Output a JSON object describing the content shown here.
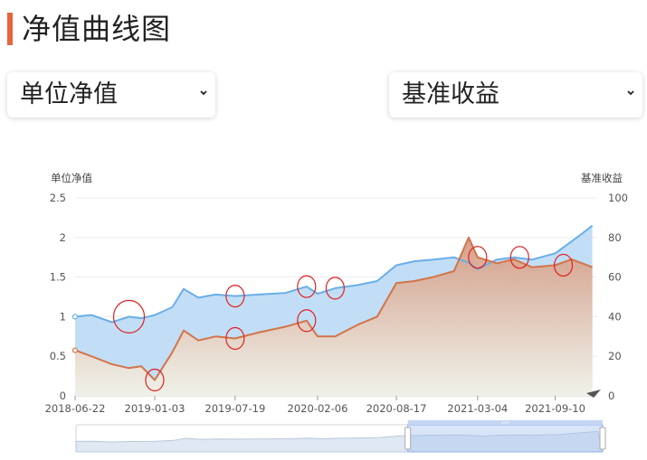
{
  "page": {
    "title": "净值曲线图"
  },
  "controls": {
    "left_select": {
      "selected": "单位净值"
    },
    "right_select": {
      "selected": "基准收益"
    }
  },
  "colors": {
    "accent": "#e8643c",
    "nav_line": "#6aaee8",
    "nav_fill": "#bcdcf7",
    "bench_line": "#d2744a",
    "bench_fill": "#d8a28a",
    "highlight": "#e02020"
  },
  "chart_data": {
    "type": "line",
    "dual_axis": true,
    "x_tick_labels": [
      "2018-06-22",
      "2019-01-03",
      "2019-07-19",
      "2020-02-06",
      "2020-08-17",
      "2021-03-04",
      "2021-09-10"
    ],
    "yleft_label": "单位净值",
    "yright_label": "基准收益",
    "yleft_ticks": [
      "0",
      "0.5",
      "1",
      "1.5",
      "2",
      "2.5"
    ],
    "yright_ticks": [
      "0",
      "20",
      "40",
      "60",
      "80",
      "100"
    ],
    "yleft_lim": [
      0,
      2.5
    ],
    "yright_lim": [
      0,
      100
    ],
    "grid": true,
    "series": [
      {
        "axis": "left",
        "color": "#6aaee8",
        "x": [
          "2018-06-22",
          "2018-08-01",
          "2018-09-20",
          "2018-11-01",
          "2018-12-01",
          "2019-01-03",
          "2019-02-15",
          "2019-03-15",
          "2019-04-20",
          "2019-06-01",
          "2019-07-19",
          "2019-09-15",
          "2019-11-20",
          "2020-01-10",
          "2020-02-06",
          "2020-03-20",
          "2020-05-15",
          "2020-07-01",
          "2020-08-17",
          "2020-09-30",
          "2020-11-15",
          "2021-01-05",
          "2021-02-10",
          "2021-03-04",
          "2021-04-20",
          "2021-06-01",
          "2021-07-15",
          "2021-09-10",
          "2021-10-20",
          "2021-11-15",
          "2021-12-10"
        ],
        "values": [
          1.0,
          1.02,
          0.93,
          1.0,
          0.98,
          1.02,
          1.12,
          1.35,
          1.24,
          1.28,
          1.26,
          1.28,
          1.3,
          1.38,
          1.29,
          1.36,
          1.4,
          1.45,
          1.65,
          1.7,
          1.72,
          1.75,
          1.68,
          1.6,
          1.72,
          1.75,
          1.72,
          1.8,
          1.95,
          2.05,
          2.15
        ]
      },
      {
        "axis": "right",
        "color": "#d2744a",
        "x": [
          "2018-06-22",
          "2018-08-01",
          "2018-09-20",
          "2018-11-01",
          "2018-12-01",
          "2019-01-03",
          "2019-02-15",
          "2019-03-15",
          "2019-04-20",
          "2019-06-01",
          "2019-07-19",
          "2019-09-15",
          "2019-11-20",
          "2020-01-10",
          "2020-02-06",
          "2020-03-20",
          "2020-05-15",
          "2020-07-01",
          "2020-08-17",
          "2020-09-30",
          "2020-11-15",
          "2021-01-05",
          "2021-02-10",
          "2021-03-04",
          "2021-04-20",
          "2021-06-01",
          "2021-07-15",
          "2021-09-10",
          "2021-10-20",
          "2021-11-15",
          "2021-12-10"
        ],
        "values": [
          23,
          20,
          16,
          14,
          15,
          8,
          22,
          33,
          28,
          30,
          29,
          32,
          35,
          38,
          30,
          30,
          36,
          40,
          57,
          58,
          60,
          63,
          80,
          70,
          67,
          69,
          65,
          66,
          69,
          67,
          65
        ]
      }
    ],
    "highlight_dates": [
      "2018-11-01",
      "2019-01-03",
      "2019-07-19",
      "2019-07-19",
      "2020-01-10",
      "2020-01-10",
      "2020-03-20",
      "2021-03-04",
      "2021-06-15",
      "2021-09-30"
    ],
    "range_slider": {
      "start_fraction": 0.63,
      "end_fraction": 1.0
    }
  }
}
